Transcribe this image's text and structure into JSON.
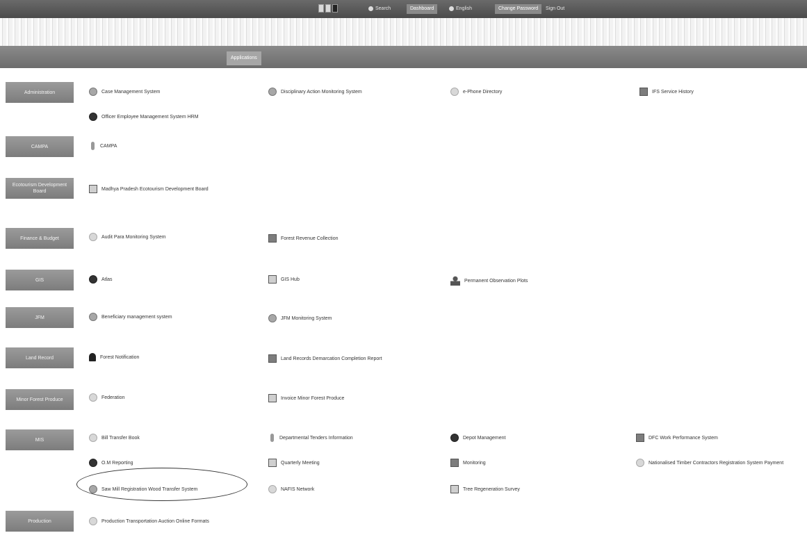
{
  "topbar": {
    "search_label": "Search",
    "tabs": [
      "Dashboard",
      "Change Password",
      "Sign Out"
    ],
    "extra": "English"
  },
  "tabbar": {
    "active_tab": "Applications"
  },
  "categories": [
    {
      "label": "Administration"
    },
    {
      "label": "CAMPA"
    },
    {
      "label": "Ecotourism Development Board"
    },
    {
      "label": "Finance & Budget"
    },
    {
      "label": "GIS"
    },
    {
      "label": "JFM"
    },
    {
      "label": "Land Record"
    },
    {
      "label": "Minor Forest Produce"
    },
    {
      "label": "MIS"
    },
    {
      "label": "Production"
    }
  ],
  "links": {
    "admin": [
      "Case Management System",
      "Disciplinary Action Monitoring System",
      "e-Phone Directory",
      "IFS Service History",
      "Officer Employee Management System HRM"
    ],
    "campa": [
      "CAMPA"
    ],
    "eco": [
      "Madhya Pradesh Ecotourism Development Board"
    ],
    "finance": [
      "Audit Para Monitoring System",
      "Forest Revenue Collection"
    ],
    "gis": [
      "Atlas",
      "GIS Hub",
      "Permanent Observation Plots"
    ],
    "jfm": [
      "Beneficiary management system",
      "JFM Monitoring System"
    ],
    "land": [
      "Forest Notification",
      "Land Records Demarcation Completion Report"
    ],
    "mfp": [
      "Federation",
      "Invoice Minor Forest Produce"
    ],
    "mis": [
      "Bill Transfer Book",
      "Departmental Tenders Information",
      "Depot Management",
      "DFC Work Performance System",
      "O.M Reporting",
      "Quarterly Meeting",
      "Monitoring",
      "Nationalised Timber Contractors Registration System Payment",
      "Saw Mill Registration Wood Transfer System",
      "NAFIS Network",
      "Tree Regeneration Survey"
    ],
    "production": [
      "Production Transportation Auction Online Formats"
    ]
  }
}
